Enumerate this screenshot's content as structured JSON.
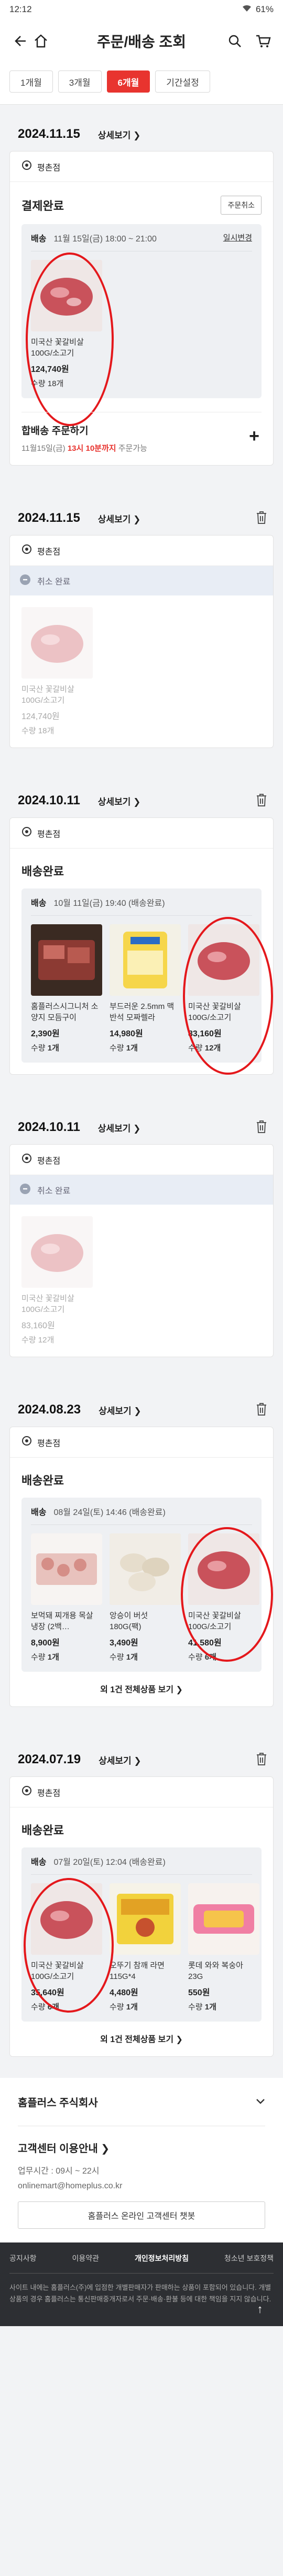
{
  "status_bar": {
    "time": "12:12",
    "battery": "61%"
  },
  "header": {
    "title": "주문/배송 조회"
  },
  "filters": [
    {
      "label": "1개월"
    },
    {
      "label": "3개월"
    },
    {
      "label": "6개월"
    },
    {
      "label": "기간설정"
    }
  ],
  "common": {
    "detail_link": "상세보기",
    "store": "평촌점",
    "cancelled": "취소 완료",
    "delivered": "배송완료"
  },
  "orders": [
    {
      "date": "2024.11.15",
      "status": "결제완료",
      "cancel_order": "주문취소",
      "delivery_label": "배송",
      "delivery_time": "11월 15일(금) 18:00 ~ 21:00",
      "edit_label": "일시변경",
      "products": [
        {
          "name": "미국산 꽃갈비살 100G/소고기",
          "price": "124,740원",
          "qty": "수량 18개"
        }
      ],
      "combine_title": "합배송 주문하기",
      "combine_pre": "11월15일(금)",
      "combine_red": "13시 10분까지",
      "combine_post": "주문가능"
    },
    {
      "date": "2024.11.15",
      "products": [
        {
          "name": "미국산 꽃갈비살 100G/소고기",
          "price": "124,740원",
          "qty": "수량 18개"
        }
      ]
    },
    {
      "date": "2024.10.11",
      "delivery_label": "배송",
      "delivery_time": "10월 11일(금) 19:40 (배송완료)",
      "products": [
        {
          "name": "홈플러스시그니처 소양지 모듬구이",
          "price": "2,390원",
          "qty_label": "수량",
          "qty_value": "1개"
        },
        {
          "name": "부드러운 2.5mm 맥반석 모짜렐라",
          "price": "14,980원",
          "qty_label": "수량",
          "qty_value": "1개"
        },
        {
          "name": "미국산 꽃갈비살 100G/소고기",
          "price": "83,160원",
          "qty_label": "수량",
          "qty_value": "12개"
        }
      ]
    },
    {
      "date": "2024.10.11",
      "products": [
        {
          "name": "미국산 꽃갈비살 100G/소고기",
          "price": "83,160원",
          "qty": "수량 12개"
        }
      ]
    },
    {
      "date": "2024.08.23",
      "delivery_label": "배송",
      "delivery_time": "08월 24일(토) 14:46 (배송완료)",
      "products": [
        {
          "name": "보먹돼 찌개용 목살 냉장 (2백…",
          "price": "8,900원",
          "qty_label": "수량",
          "qty_value": "1개"
        },
        {
          "name": "앙승이 버섯 180G(팩)",
          "price": "3,490원",
          "qty_label": "수량",
          "qty_value": "1개"
        },
        {
          "name": "미국산 꽃갈비살 100G/소고기",
          "price": "41,580원",
          "qty_label": "수량",
          "qty_value": "6개"
        }
      ],
      "more": "외 1건 전체상품 보기"
    },
    {
      "date": "2024.07.19",
      "delivery_label": "배송",
      "delivery_time": "07월 20일(토) 12:04 (배송완료)",
      "products": [
        {
          "name": "미국산 꽃갈비살 100G/소고기",
          "price": "35,640원",
          "qty_label": "수량",
          "qty_value": "6개"
        },
        {
          "name": "오뚜기 참깨 라면 115G*4",
          "price": "4,480원",
          "qty_label": "수량",
          "qty_value": "1개"
        },
        {
          "name": "롯데 와와 복숭아 23G",
          "price": "550원",
          "qty_label": "수량",
          "qty_value": "1개"
        }
      ],
      "more": "외 1건 전체상품 보기"
    }
  ],
  "footer": {
    "company": "홈플러스 주식회사",
    "cs_title": "고객센터 이용안내",
    "hours": "업무시간 : 09시 ~ 22시",
    "email": "onlinemart@homeplus.co.kr",
    "chat": "홈플러스 온라인 고객센터 챗봇",
    "links": [
      "공지사항",
      "이용약관",
      "개인정보처리방침",
      "청소년 보호정책"
    ],
    "note": "사이트 내에는 홈플러스(주)에 입점한 개별판매자가 판매하는 상품이 포함되어 있습니다. 개별 상품의 경우 홈플러스는 통신판매중개자로서 주문·배송·환불 등에 대한 책임을 지지 않습니다."
  },
  "colors": {
    "accent": "#e8342f",
    "annotation": "#e4181c"
  }
}
